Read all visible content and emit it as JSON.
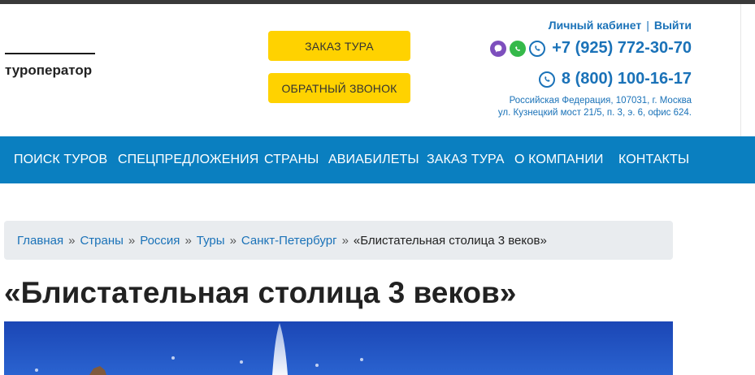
{
  "header": {
    "logo_subtitle": "туроператор",
    "order_button": "ЗАКАЗ ТУРА",
    "callback_button": "ОБРАТНЫЙ ЗВОНОК",
    "account": {
      "cabinet": "Личный кабинет",
      "separator": "|",
      "logout": "Выйти"
    },
    "phones": [
      {
        "number": "+7 (925) 772-30-70",
        "icons": [
          "viber-icon",
          "whatsapp-icon",
          "phone-icon"
        ]
      },
      {
        "number": "8 (800) 100-16-17",
        "icons": [
          "phone-icon"
        ]
      }
    ],
    "address_line1": "Российская Федерация, 107031, г. Москва",
    "address_line2": "ул. Кузнецкий мост 21/5, п. 3, э. 6, офис 624."
  },
  "nav": {
    "items": [
      "Поиск туров",
      "Спецпредложения",
      "Страны",
      "Авиабилеты",
      "Заказ тура",
      "О компании",
      "Контакты"
    ]
  },
  "breadcrumb": {
    "items": [
      "Главная",
      "Страны",
      "Россия",
      "Туры",
      "Санкт-Петербург"
    ],
    "separator": "»",
    "current": "«Блистательная столица 3 веков»"
  },
  "page": {
    "title": "«Блистательная столица 3 веков»"
  },
  "colors": {
    "accent": "#1a72b8",
    "nav_bg": "#0a7fc0",
    "button_bg": "#ffd200",
    "breadcrumb_bg": "#e9ecef"
  }
}
